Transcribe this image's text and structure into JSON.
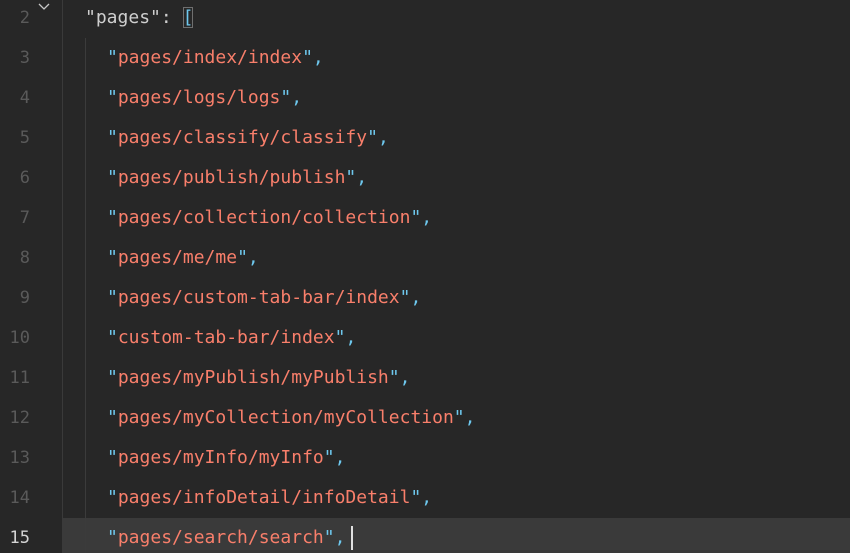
{
  "editor": {
    "top_line": {
      "number": "2",
      "key": "pages",
      "separator": ": ",
      "bracket": "["
    },
    "current_line": "15",
    "lines": [
      {
        "number": "3",
        "value": "pages/index/index"
      },
      {
        "number": "4",
        "value": "pages/logs/logs"
      },
      {
        "number": "5",
        "value": "pages/classify/classify"
      },
      {
        "number": "6",
        "value": "pages/publish/publish"
      },
      {
        "number": "7",
        "value": "pages/collection/collection"
      },
      {
        "number": "8",
        "value": "pages/me/me"
      },
      {
        "number": "9",
        "value": "pages/custom-tab-bar/index"
      },
      {
        "number": "10",
        "value": "custom-tab-bar/index"
      },
      {
        "number": "11",
        "value": "pages/myPublish/myPublish"
      },
      {
        "number": "12",
        "value": "pages/myCollection/myCollection"
      },
      {
        "number": "13",
        "value": "pages/myInfo/myInfo"
      },
      {
        "number": "14",
        "value": "pages/infoDetail/infoDetail"
      },
      {
        "number": "15",
        "value": "pages/search/search"
      }
    ],
    "colors": {
      "background": "#272727",
      "string": "#f97f6b",
      "quote": "#6ec8ee",
      "line_number": "#5a5a5a",
      "current_line_bg": "#3a3a3a"
    }
  }
}
